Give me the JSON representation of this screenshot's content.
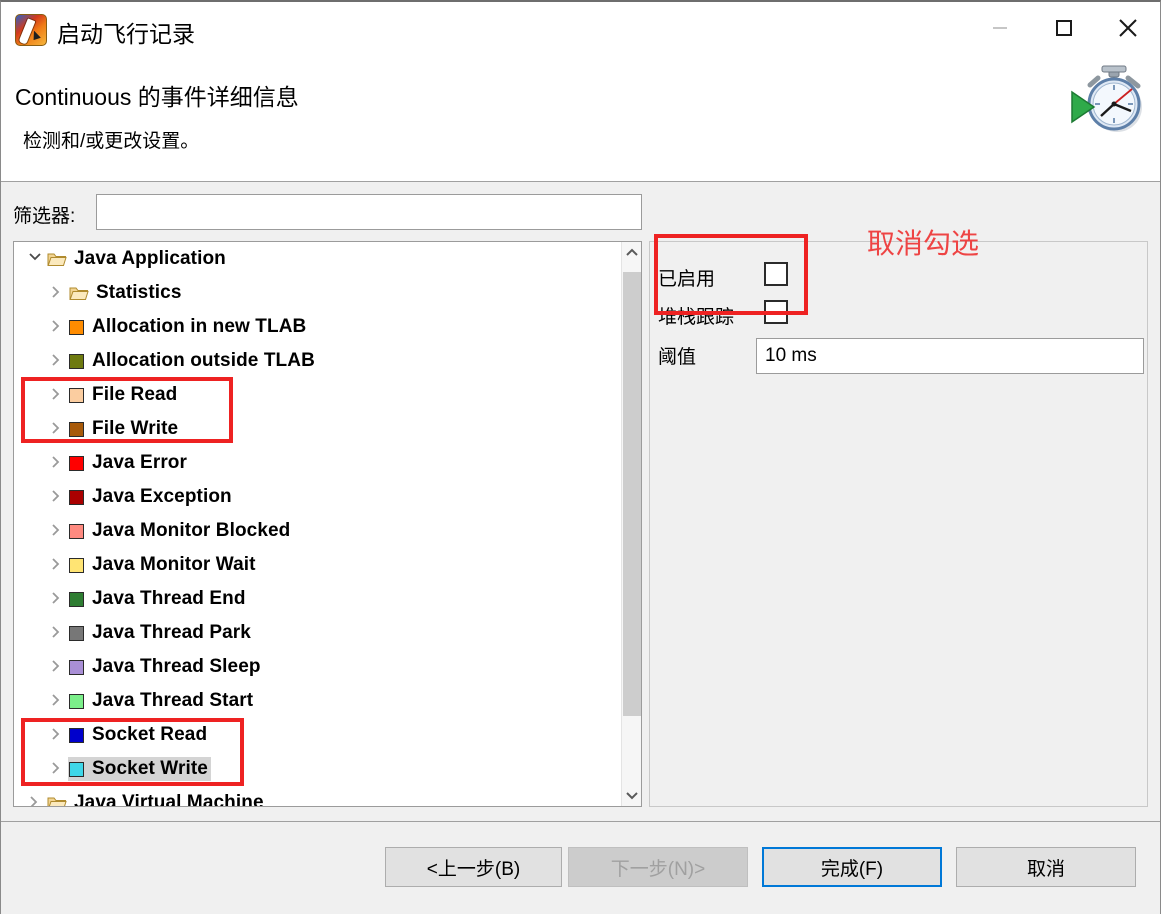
{
  "window": {
    "title": "启动飞行记录",
    "icon": "flight-recorder-icon",
    "minimize_label": "—",
    "maximize_label": "□",
    "close_label": "✕"
  },
  "header": {
    "title": "Continuous 的事件详细信息",
    "description": "检测和/或更改设置。",
    "image": "stopwatch-play-icon"
  },
  "filter": {
    "label": "筛选器:",
    "value": "",
    "placeholder": ""
  },
  "tree": {
    "rows": [
      {
        "label": "Java Application",
        "indent": 0,
        "chevron": "down",
        "icon": "folder",
        "color": null,
        "selected": false
      },
      {
        "label": "Statistics",
        "indent": 1,
        "chevron": "right",
        "icon": "folder",
        "color": null,
        "selected": false
      },
      {
        "label": "Allocation in new TLAB",
        "indent": 1,
        "chevron": "right",
        "icon": "square",
        "color": "#FF8C00",
        "selected": false
      },
      {
        "label": "Allocation outside TLAB",
        "indent": 1,
        "chevron": "right",
        "icon": "square",
        "color": "#6E7A0F",
        "selected": false
      },
      {
        "label": "File Read",
        "indent": 1,
        "chevron": "right",
        "icon": "square",
        "color": "#FBCDA0",
        "selected": false
      },
      {
        "label": "File Write",
        "indent": 1,
        "chevron": "right",
        "icon": "square",
        "color": "#A85A09",
        "selected": false
      },
      {
        "label": "Java Error",
        "indent": 1,
        "chevron": "right",
        "icon": "square",
        "color": "#FF0000",
        "selected": false
      },
      {
        "label": "Java Exception",
        "indent": 1,
        "chevron": "right",
        "icon": "square",
        "color": "#AA0000",
        "selected": false
      },
      {
        "label": "Java Monitor Blocked",
        "indent": 1,
        "chevron": "right",
        "icon": "square",
        "color": "#FF8A80",
        "selected": false
      },
      {
        "label": "Java Monitor Wait",
        "indent": 1,
        "chevron": "right",
        "icon": "square",
        "color": "#FFE473",
        "selected": false
      },
      {
        "label": "Java Thread End",
        "indent": 1,
        "chevron": "right",
        "icon": "square",
        "color": "#2E7D32",
        "selected": false
      },
      {
        "label": "Java Thread Park",
        "indent": 1,
        "chevron": "right",
        "icon": "square",
        "color": "#777777",
        "selected": false
      },
      {
        "label": "Java Thread Sleep",
        "indent": 1,
        "chevron": "right",
        "icon": "square",
        "color": "#A98FD6",
        "selected": false
      },
      {
        "label": "Java Thread Start",
        "indent": 1,
        "chevron": "right",
        "icon": "square",
        "color": "#7BEF8A",
        "selected": false
      },
      {
        "label": "Socket Read",
        "indent": 1,
        "chevron": "right",
        "icon": "square",
        "color": "#0000CC",
        "selected": false
      },
      {
        "label": "Socket Write",
        "indent": 1,
        "chevron": "right",
        "icon": "square",
        "color": "#3FD7E8",
        "selected": true
      },
      {
        "label": "Java Virtual Machine",
        "indent": 0,
        "chevron": "right",
        "icon": "folder",
        "color": null,
        "selected": false
      }
    ],
    "scrollbar": {
      "up_arrow": "chevron-up",
      "down_arrow": "chevron-down"
    }
  },
  "details": {
    "enabled_label": "已启用",
    "enabled_checked": false,
    "stacktrace_label": "堆栈跟踪",
    "stacktrace_checked": false,
    "threshold_label": "阈值",
    "threshold_value": "10 ms"
  },
  "annotations": {
    "uncheck_text": "取消勾选",
    "color": "#ee4444",
    "box_color": "#ee2222"
  },
  "footer": {
    "back_label": "<上一步(B)",
    "next_label": "下一步(N)>",
    "finish_label": "完成(F)",
    "cancel_label": "取消"
  }
}
